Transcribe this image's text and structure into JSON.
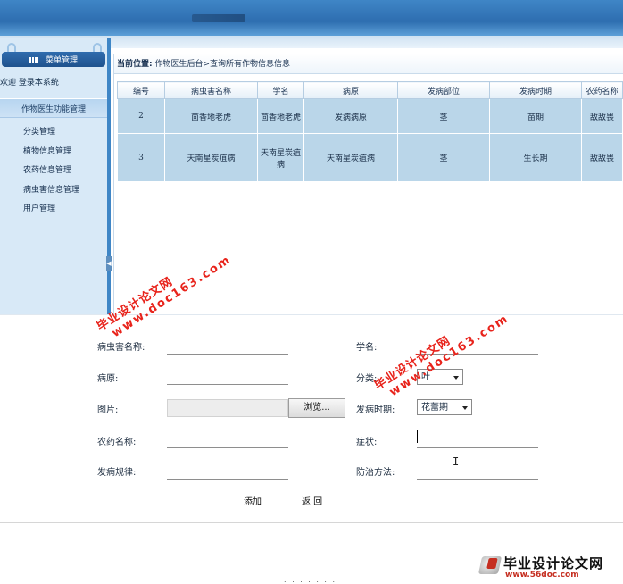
{
  "header": {
    "title": ""
  },
  "sidebar": {
    "menu_title": "菜单管理",
    "welcome": "欢迎 登录本系统",
    "section_title": "作物医生功能管理",
    "items": [
      {
        "label": "分类管理"
      },
      {
        "label": "植物信息管理"
      },
      {
        "label": "农药信息管理"
      },
      {
        "label": "病虫害信息管理"
      },
      {
        "label": "用户管理"
      }
    ],
    "collapse_glyph": "◀"
  },
  "breadcrumb": {
    "prefix": "当前位置:",
    "path": "作物医生后台>查询所有作物信息信息"
  },
  "table": {
    "columns": [
      "编号",
      "病虫害名称",
      "学名",
      "病原",
      "发病部位",
      "发病时期",
      "农药名称"
    ],
    "rows": [
      [
        "2",
        "茴香地老虎",
        "茴香地老虎",
        "发病病原",
        "茎",
        "苗期",
        "敌敌畏"
      ],
      [
        "3",
        "天南星炭疽病",
        "天南星炭疽病",
        "天南星炭疽病",
        "茎",
        "生长期",
        "敌敌畏"
      ]
    ]
  },
  "form": {
    "labels": {
      "pest_name": "病虫害名称:",
      "scientific_name": "学名:",
      "pathogen": "病原:",
      "category": "分类:",
      "image": "图片:",
      "onset_period": "发病时期:",
      "pesticide_name": "农药名称:",
      "symptoms": "症状:",
      "onset_pattern": "发病规律:",
      "prevention": "防治方法:"
    },
    "values": {
      "pest_name": "",
      "scientific_name": "",
      "pathogen": "",
      "pesticide_name": "",
      "symptoms": "",
      "onset_pattern": "",
      "prevention": ""
    },
    "browse_label": "浏览...",
    "category_selected": "叶",
    "period_selected": "花蕾期",
    "add_label": "添加",
    "back_label": "返 回"
  },
  "watermarks": [
    {
      "line1": "毕业设计论文网",
      "line2": "www.doc163.com"
    },
    {
      "line1": "毕业设计论文网",
      "line2": "www.doc163.com"
    }
  ],
  "logo": {
    "name": "毕业设计论文网",
    "url": "www.56doc.com"
  },
  "footer": {
    "dots": ". . . . . . ."
  },
  "colors": {
    "accent": "#3f86c6",
    "table_row": "#bad6e9",
    "watermark": "#e8231b"
  }
}
